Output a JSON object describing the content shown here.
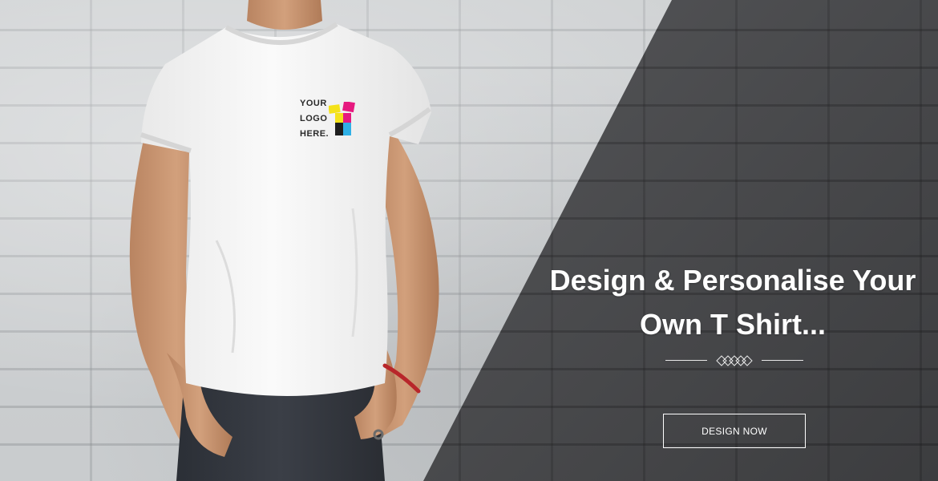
{
  "hero": {
    "headline_line1": "Design & Personalise Your",
    "headline_line2": "Own T Shirt...",
    "cta_label": "DESIGN NOW"
  },
  "shirt_logo": {
    "line1": "YOUR",
    "line2": "LOGO",
    "line3": "HERE.",
    "icon": "t-shirt-cmyk-icon"
  },
  "divider": {
    "icon": "diamond-ornament-icon"
  },
  "colors": {
    "panel_dark": "#4d4e51",
    "wall_light": "#c6c9cb",
    "text": "#ffffff",
    "logo_yellow": "#f4e21a",
    "logo_magenta": "#e6197f",
    "logo_cyan": "#2fb0e6",
    "logo_black": "#1e1e1e"
  }
}
